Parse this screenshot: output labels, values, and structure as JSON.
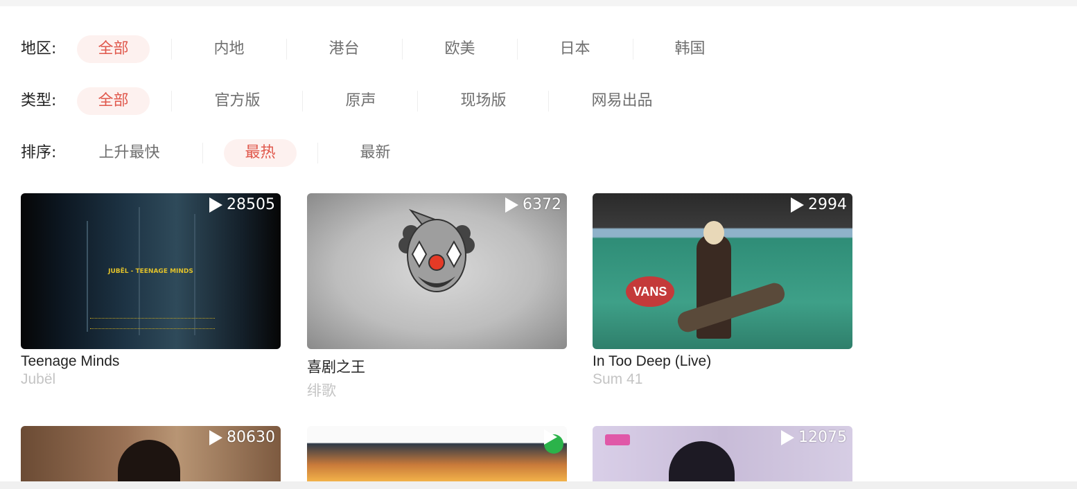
{
  "filters": {
    "region": {
      "label": "地区:",
      "options": [
        "全部",
        "内地",
        "港台",
        "欧美",
        "日本",
        "韩国"
      ],
      "selected": "全部"
    },
    "type": {
      "label": "类型:",
      "options": [
        "全部",
        "官方版",
        "原声",
        "现场版",
        "网易出品"
      ],
      "selected": "全部"
    },
    "sort": {
      "label": "排序:",
      "options": [
        "上升最快",
        "最热",
        "最新"
      ],
      "selected": "最热"
    }
  },
  "accent_color": "#e0584c",
  "videos": [
    {
      "title": "Teenage Minds",
      "artist": "Jubël",
      "plays": "28505",
      "thumb_text": "JUBËL - TEENAGE MINDS"
    },
    {
      "title": "喜剧之王",
      "artist": "绯歌",
      "plays": "6372"
    },
    {
      "title": "In Too Deep (Live)",
      "artist": "Sum 41",
      "plays": "2994",
      "thumb_text": "VANS"
    },
    {
      "title": "",
      "artist": "",
      "plays": "80630"
    },
    {
      "title": "",
      "artist": "",
      "plays": ""
    },
    {
      "title": "",
      "artist": "",
      "plays": "12075"
    }
  ],
  "icons": {
    "play": "play-triangle-icon"
  }
}
